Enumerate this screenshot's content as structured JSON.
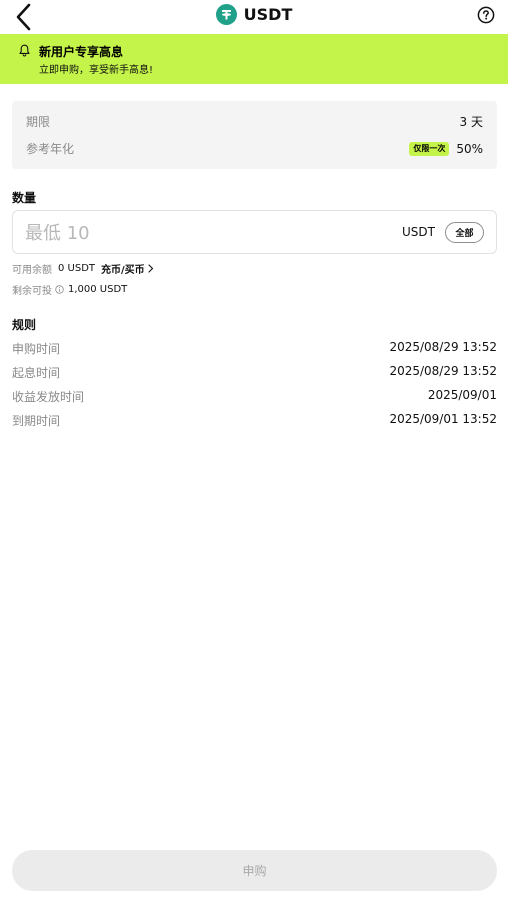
{
  "header": {
    "title": "USDT",
    "coin_icon": "tether-coin-icon",
    "accent": "#21a08a"
  },
  "banner": {
    "title": "新用户专享高息",
    "subtitle": "立即申购，享受新手高息!",
    "bg": "#c4f34a"
  },
  "info": {
    "term_label": "期限",
    "term_value": "3 天",
    "apr_label": "参考年化",
    "apr_badge": "仅限一次",
    "apr_value": "50%"
  },
  "amount": {
    "section_label": "数量",
    "placeholder": "最低 10",
    "unit": "USDT",
    "all_label": "全部"
  },
  "balance": {
    "available_label": "可用余额",
    "available_value": "0 USDT",
    "deposit_link": "充币/买币",
    "remaining_label": "剩余可投",
    "remaining_value": "1,000 USDT"
  },
  "rules": {
    "title": "规则",
    "items": [
      {
        "label": "申购时间",
        "value": "2025/08/29 13:52"
      },
      {
        "label": "起息时间",
        "value": "2025/08/29 13:52"
      },
      {
        "label": "收益发放时间",
        "value": "2025/09/01"
      },
      {
        "label": "到期时间",
        "value": "2025/09/01 13:52"
      }
    ]
  },
  "submit": {
    "label": "申购"
  }
}
